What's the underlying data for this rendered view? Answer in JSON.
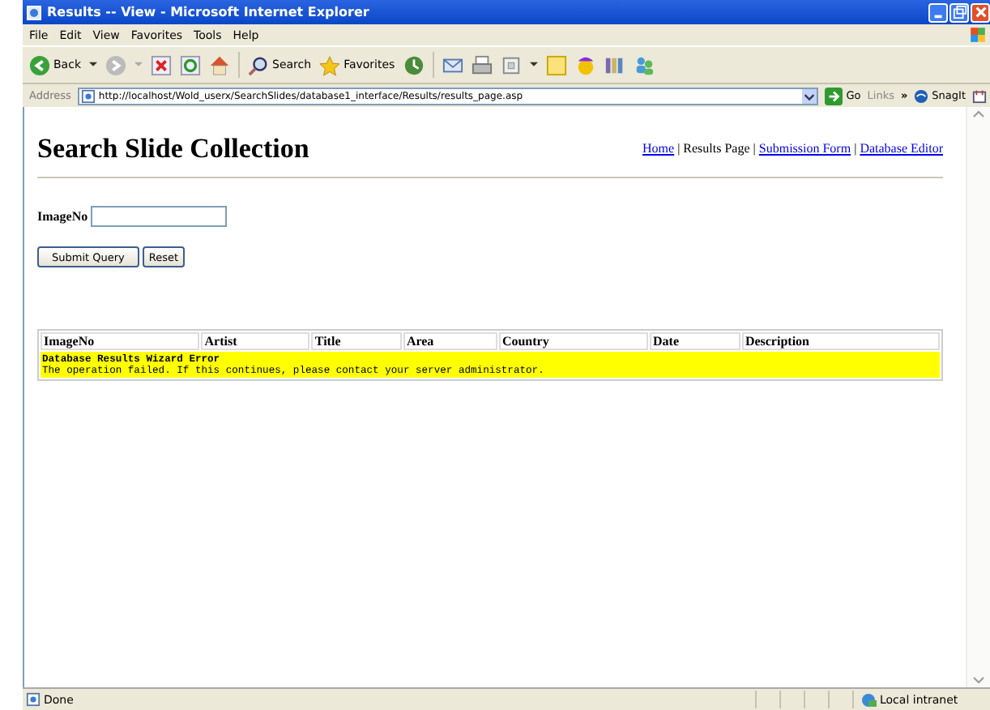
{
  "window": {
    "title": "Results -- View - Microsoft Internet Explorer"
  },
  "menu": [
    "File",
    "Edit",
    "View",
    "Favorites",
    "Tools",
    "Help"
  ],
  "toolbar": {
    "back": "Back",
    "search": "Search",
    "favorites": "Favorites"
  },
  "address_bar": {
    "label": "Address",
    "url": "http://localhost/Wold_userx/SearchSlides/database1_interface/Results/results_page.asp",
    "go": "Go",
    "links": "Links",
    "links_chevron": "»",
    "snagit": "SnagIt"
  },
  "page": {
    "heading": "Search Slide Collection",
    "nav": [
      {
        "text": "Home",
        "kind": "link"
      },
      {
        "text": "|",
        "kind": "sep"
      },
      {
        "text": "Results Page",
        "kind": "text"
      },
      {
        "text": "|",
        "kind": "sep"
      },
      {
        "text": "Submission Form",
        "kind": "link"
      },
      {
        "text": "|",
        "kind": "sep"
      },
      {
        "text": "Database Editor",
        "kind": "link"
      }
    ],
    "form": {
      "label": "ImageNo",
      "buttons": [
        "Submit Query",
        "Reset"
      ]
    },
    "table": {
      "columns": [
        "ImageNo",
        "Artist",
        "Title",
        "Area",
        "Country",
        "Date",
        "Description"
      ],
      "error": {
        "title": "Database Results Wizard Error",
        "message": "The operation failed. If this continues, please contact your server administrator."
      }
    }
  },
  "status_bar": {
    "text": "Done",
    "zone": "Local intranet"
  }
}
